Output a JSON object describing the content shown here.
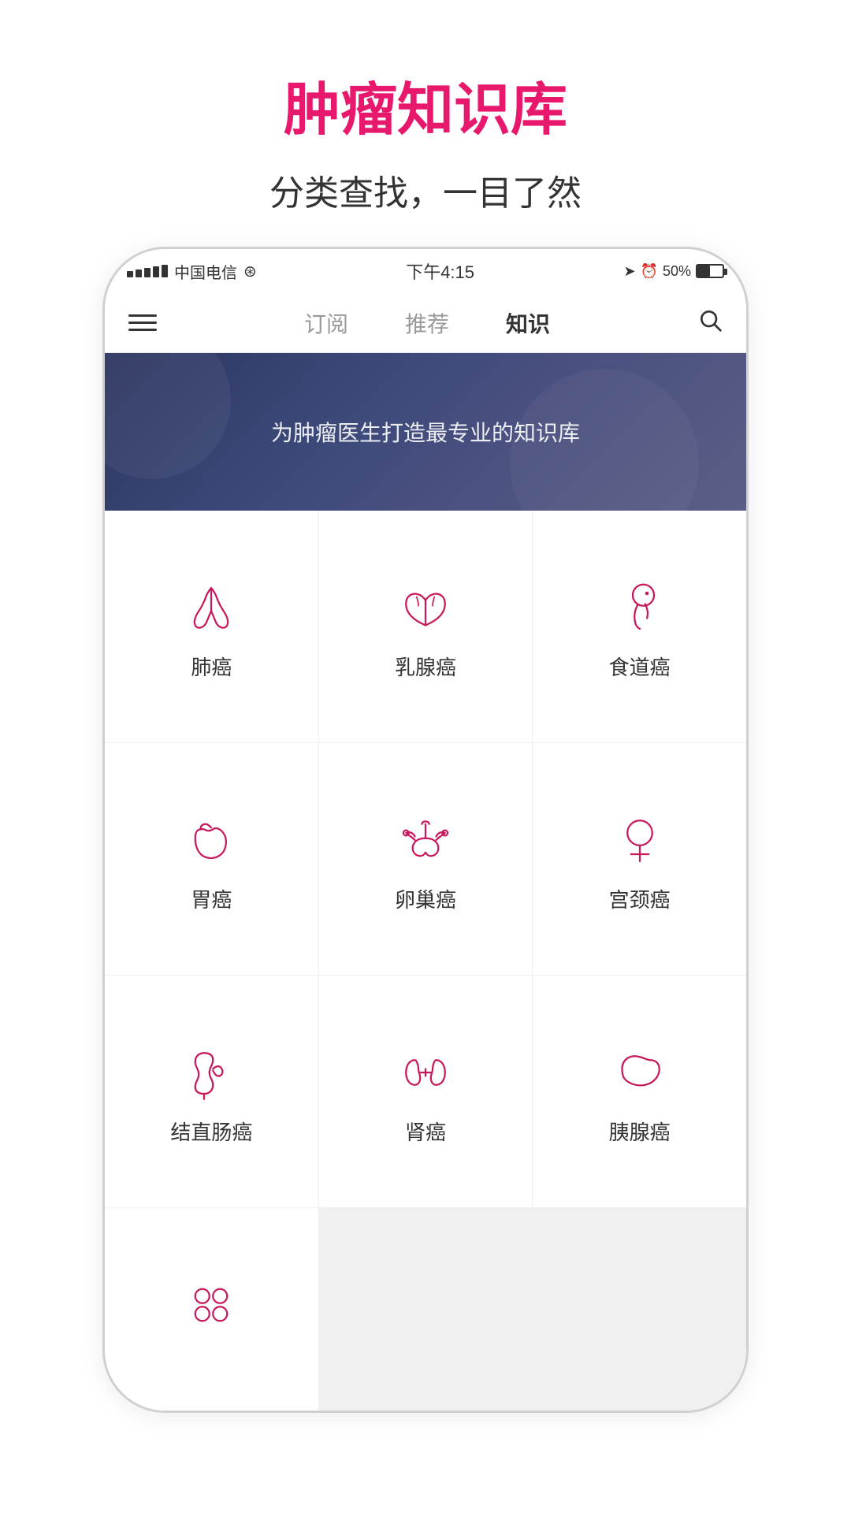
{
  "header": {
    "title": "肿瘤知识库",
    "subtitle": "分类查找，一目了然"
  },
  "status_bar": {
    "carrier": "中国电信",
    "time": "下午4:15",
    "battery": "50%"
  },
  "nav": {
    "tabs": [
      {
        "label": "订阅",
        "active": false
      },
      {
        "label": "推荐",
        "active": false
      },
      {
        "label": "知识",
        "active": true
      }
    ]
  },
  "banner": {
    "text": "为肿瘤医生打造最专业的知识库"
  },
  "categories": [
    {
      "id": "lung",
      "label": "肺癌",
      "icon": "lung"
    },
    {
      "id": "breast",
      "label": "乳腺癌",
      "icon": "breast"
    },
    {
      "id": "esophagus",
      "label": "食道癌",
      "icon": "esophagus"
    },
    {
      "id": "stomach",
      "label": "胃癌",
      "icon": "stomach"
    },
    {
      "id": "ovary",
      "label": "卵巢癌",
      "icon": "ovary"
    },
    {
      "id": "cervix",
      "label": "宫颈癌",
      "icon": "cervix"
    },
    {
      "id": "colon",
      "label": "结直肠癌",
      "icon": "colon"
    },
    {
      "id": "kidney",
      "label": "肾癌",
      "icon": "kidney"
    },
    {
      "id": "pancreas",
      "label": "胰腺癌",
      "icon": "pancreas"
    },
    {
      "id": "more",
      "label": "",
      "icon": "more"
    }
  ],
  "colors": {
    "accent": "#c8185d",
    "text_dark": "#333333",
    "text_muted": "#999999"
  }
}
